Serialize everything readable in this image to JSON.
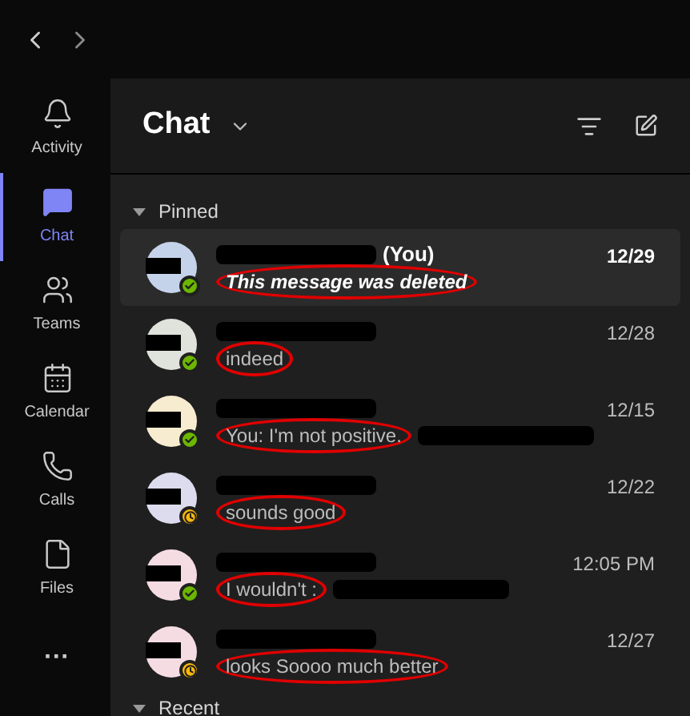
{
  "rail": [
    {
      "label": "Activity",
      "selected": false
    },
    {
      "label": "Chat",
      "selected": true
    },
    {
      "label": "Teams",
      "selected": false
    },
    {
      "label": "Calendar",
      "selected": false
    },
    {
      "label": "Calls",
      "selected": false
    },
    {
      "label": "Files",
      "selected": false
    },
    {
      "label": "···",
      "selected": false
    }
  ],
  "header": {
    "title": "Chat"
  },
  "sections": [
    {
      "label": "Pinned",
      "expanded": true,
      "chats": [
        {
          "name_suffix": "(You)",
          "preview": "This message was deleted",
          "kind": "deleted",
          "time": "12/29",
          "unread": true,
          "selected": true,
          "away": false,
          "color": "#c5d3ea",
          "preview_redacted": false
        },
        {
          "preview": "indeed",
          "kind": "message",
          "time": "12/28",
          "unread": false,
          "selected": false,
          "away": false,
          "color": "#dfe3dc",
          "preview_redacted": false
        },
        {
          "preview": "You: I'm not positive.",
          "kind": "message",
          "time": "12/15",
          "unread": false,
          "selected": false,
          "away": false,
          "color": "#f8ecd0",
          "preview_redacted": true
        },
        {
          "preview": "sounds good",
          "kind": "message",
          "time": "12/22",
          "unread": false,
          "selected": false,
          "away": true,
          "color": "#dcdcee",
          "preview_redacted": false
        },
        {
          "preview": "I wouldn't :",
          "kind": "message",
          "time": "12:05 PM",
          "unread": false,
          "selected": false,
          "away": false,
          "color": "#f5dce3",
          "preview_redacted": true
        },
        {
          "preview": "looks Soooo much better",
          "kind": "message",
          "time": "12/27",
          "unread": false,
          "selected": false,
          "away": true,
          "color": "#f5dce3",
          "preview_redacted": false
        }
      ]
    },
    {
      "label": "Recent",
      "expanded": true
    }
  ]
}
